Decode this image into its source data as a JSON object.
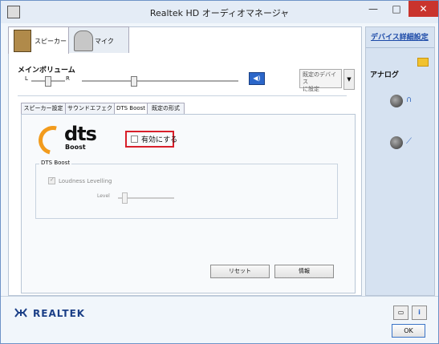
{
  "window": {
    "title": "Realtek HD オーディオマネージャ",
    "minimize": "—",
    "maximize": "□",
    "close": "✕"
  },
  "device_tabs": [
    {
      "label": "スピーカー"
    },
    {
      "label": "マイク"
    }
  ],
  "volume": {
    "label": "メインボリューム",
    "left": "L",
    "right": "R",
    "balance_position": 0.6,
    "level": 0.33
  },
  "default_device": {
    "line1": "既定のデバイス",
    "line2": "に設定",
    "arrow": "▼"
  },
  "sub_tabs": [
    {
      "label": "スピーカー設定"
    },
    {
      "label": "サウンドエフェクト"
    },
    {
      "label": "DTS Boost"
    },
    {
      "label": "既定の形式"
    }
  ],
  "dts": {
    "logo": "dts",
    "logo_sub": "Boost",
    "enable_label": "有効にする",
    "enabled": false
  },
  "dts_group": {
    "title": "DTS Boost",
    "loudness_label": "Loudness Levelling",
    "loudness_checked": true,
    "level_label": "Level"
  },
  "buttons": {
    "reset": "リセット",
    "info": "情報",
    "ok": "OK"
  },
  "right_panel": {
    "link": "デバイス詳細設定",
    "analog": "アナログ",
    "jack1_icon": "headphones-icon",
    "jack2_icon": "microphone-icon"
  },
  "footer": {
    "brand": "REALTEK"
  },
  "colors": {
    "accent": "#2b66c9",
    "highlight_red": "#d81f2a",
    "dts_orange": "#f29b1d",
    "brand_blue": "#1b3f87"
  }
}
